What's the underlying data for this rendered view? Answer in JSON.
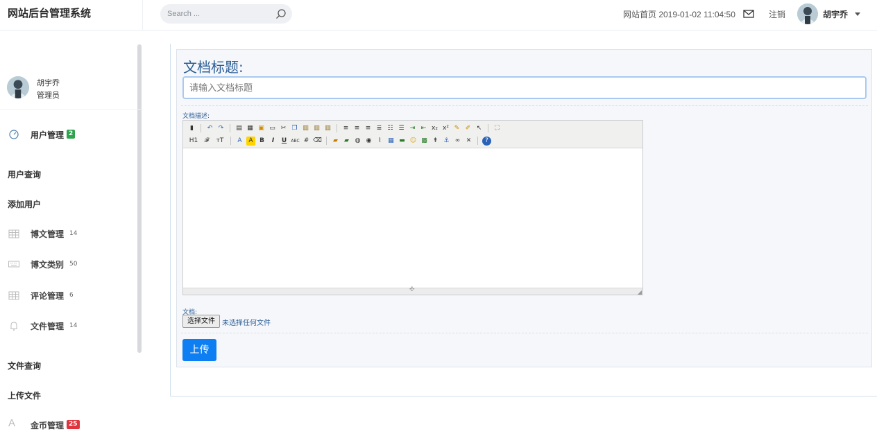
{
  "header": {
    "brand": "网站后台管理系统",
    "search_placeholder": "Search ...",
    "home_link": "网站首页 2019-01-02 11:04:50",
    "logout": "注销",
    "user": "胡宇乔"
  },
  "sidebar": {
    "profile_name": "胡宇乔",
    "profile_role": "管理员",
    "items": [
      {
        "label": "用户管理",
        "badge": "2",
        "badge_color": "#2ea44f",
        "icon": "dashboard-icon"
      },
      {
        "label": "用户查询"
      },
      {
        "label": "添加用户"
      },
      {
        "label": "博文管理",
        "count": "14",
        "icon": "grid-icon"
      },
      {
        "label": "博文类别",
        "count": "50",
        "icon": "keyboard-icon"
      },
      {
        "label": "评论管理",
        "count": "6",
        "icon": "grid-icon"
      },
      {
        "label": "文件管理",
        "count": "14",
        "icon": "bell-icon"
      },
      {
        "label": "文件查询"
      },
      {
        "label": "上传文件"
      },
      {
        "label": "金币管理",
        "badge": "25",
        "badge_color": "#e0343c",
        "icon": "font-icon"
      }
    ]
  },
  "form": {
    "title_label": "文档标题:",
    "title_placeholder": "请输入文档标题",
    "desc_label": "文档描述:",
    "file_label": "文档:",
    "file_button": "选择文件",
    "file_status": "未选择任何文件",
    "submit": "上传"
  },
  "editor": {
    "toolbar_row2_text": [
      "H1",
      "𝓕",
      "тT"
    ]
  },
  "colors": {
    "accent": "#0d7ff2",
    "label_blue": "#2a5d96"
  }
}
